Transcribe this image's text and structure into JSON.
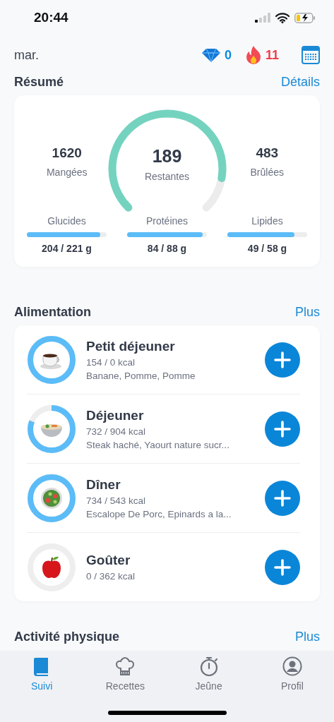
{
  "status_bar": {
    "time": "20:44"
  },
  "header": {
    "date": "mar.",
    "gems": "0",
    "streak": "11"
  },
  "summary": {
    "title": "Résumé",
    "link": "Détails",
    "eaten": {
      "value": "1620",
      "label": "Mangées"
    },
    "remaining": {
      "value": "189",
      "label": "Restantes",
      "level": 0.87
    },
    "burned": {
      "value": "483",
      "label": "Brûlées"
    },
    "macros": [
      {
        "label": "Glucides",
        "level": 0.92,
        "reading": "204 / 221 g"
      },
      {
        "label": "Protéines",
        "level": 0.95,
        "reading": "84 / 88 g"
      },
      {
        "label": "Lipides",
        "level": 0.84,
        "reading": "49 / 58 g"
      }
    ]
  },
  "food": {
    "title": "Alimentation",
    "link": "Plus",
    "meals": [
      {
        "kind": "coffee",
        "name": "Petit déjeuner",
        "kcal": "154 / 0 kcal",
        "items": "Banane, Pomme, Pomme",
        "level": 1
      },
      {
        "kind": "soup",
        "name": "Déjeuner",
        "kcal": "732 / 904 kcal",
        "items": "Steak haché, Yaourt nature sucr...",
        "level": 0.81
      },
      {
        "kind": "salad",
        "name": "Dîner",
        "kcal": "734 / 543 kcal",
        "items": "Escalope De Porc, Epinards a la...",
        "level": 1
      },
      {
        "kind": "apple",
        "name": "Goûter",
        "kcal": "0 / 362 kcal",
        "level": 0
      }
    ]
  },
  "activity": {
    "title": "Activité physique",
    "link": "Plus"
  },
  "tabs": [
    {
      "kind": "book",
      "label": "Suivi",
      "selected": true
    },
    {
      "kind": "chef",
      "label": "Recettes",
      "selected": false
    },
    {
      "kind": "timer",
      "label": "Jeûne",
      "selected": false
    },
    {
      "kind": "profile",
      "label": "Profil",
      "selected": false
    }
  ]
}
